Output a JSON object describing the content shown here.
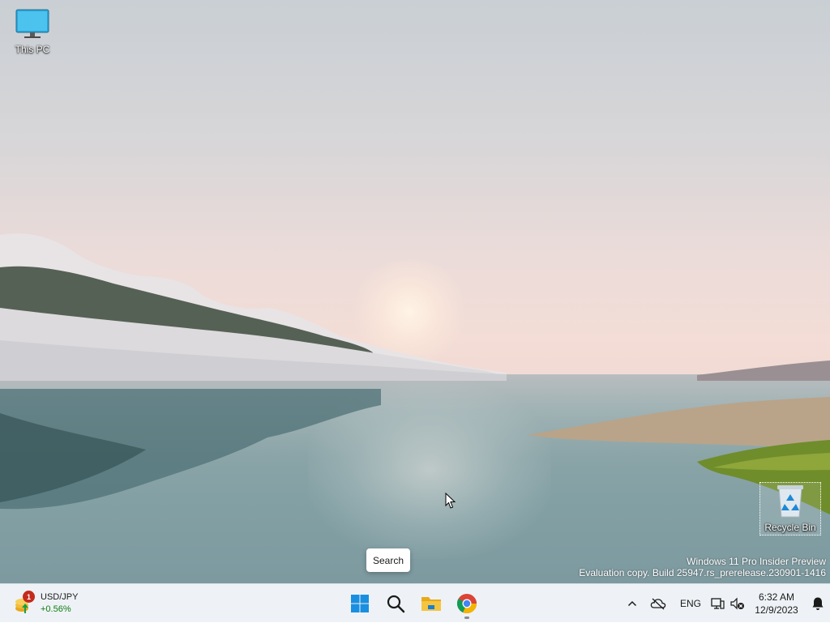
{
  "desktop": {
    "icons": [
      {
        "label": "This PC",
        "icon": "monitor-icon"
      },
      {
        "label": "Recycle Bin",
        "icon": "recycle-bin-icon"
      }
    ],
    "watermark": {
      "line1": "Windows 11 Pro Insider Preview",
      "line2": "Evaluation copy. Build 25947.rs_prerelease.230901-1416"
    },
    "tooltip": "Search"
  },
  "taskbar": {
    "widget": {
      "badge": "1",
      "title": "USD/JPY",
      "change": "+0.56%",
      "change_color": "#107c10"
    },
    "apps": [
      {
        "name": "start-button",
        "icon": "windows-logo-icon"
      },
      {
        "name": "search-button",
        "icon": "search-icon"
      },
      {
        "name": "file-explorer-button",
        "icon": "folder-icon"
      },
      {
        "name": "chrome-button",
        "icon": "chrome-icon",
        "active": true
      }
    ],
    "tray": {
      "language": "ENG",
      "time": "6:32 AM",
      "date": "12/9/2023"
    }
  }
}
